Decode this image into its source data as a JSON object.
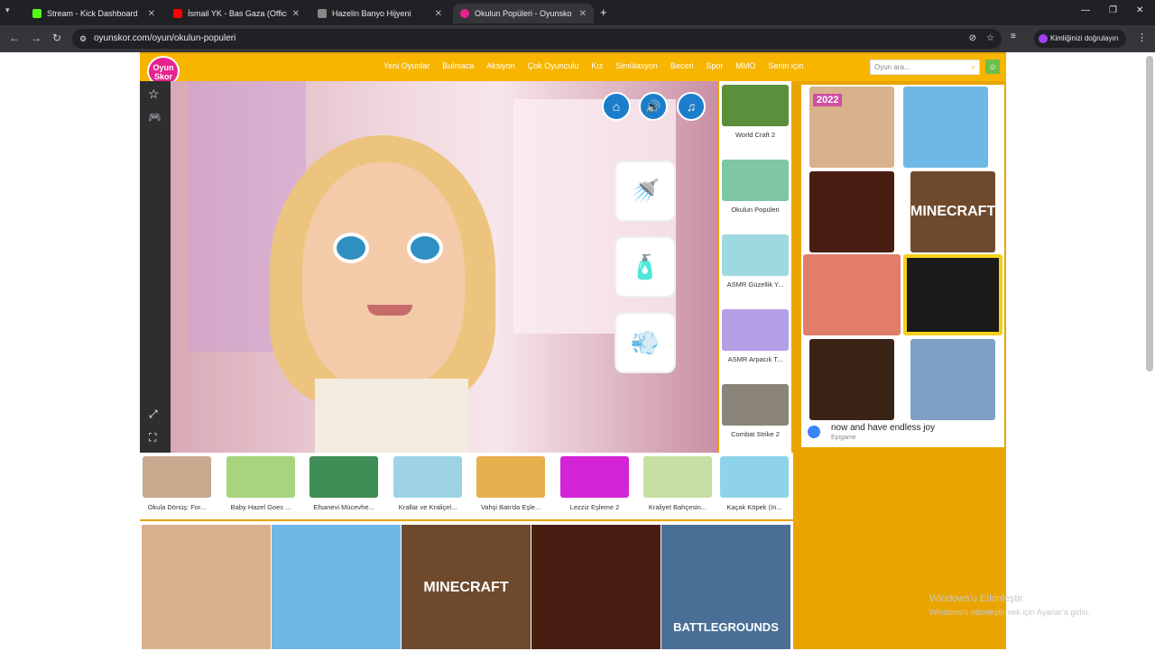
{
  "tabs": [
    {
      "title": "Stream - Kick Dashboard",
      "color": "#53fc18"
    },
    {
      "title": "İsmail YK - Bas Gaza (Offici",
      "color": "#ff0000"
    },
    {
      "title": "Hazelin Banyo Hijyeni",
      "color": "#888888"
    },
    {
      "title": "Okulun Popüleri - Oyunsko",
      "color": "#e8238e"
    }
  ],
  "address": {
    "url": "oyunskor.com/oyun/okulun-populeri",
    "profile": "Kimliğinizi doğrulayın"
  },
  "site": {
    "logo": "Oyun Skor",
    "nav": [
      "Yeni Oyunlar",
      "Bulmaca",
      "Aksiyon",
      "Çok Oyunculu",
      "Kız",
      "Simülasyon",
      "Beceri",
      "Spor",
      "MMO",
      "Senin için"
    ],
    "search_placeholder": "Oyun ara..."
  },
  "side_games": [
    "World Craft 2",
    "Okulun Popüleri",
    "ASMR Güzellik Y...",
    "ASMR Arpacık T...",
    "Combat Strike 2"
  ],
  "bottom_games": [
    "Okula Dönüş: For...",
    "Baby Hazel Goes ...",
    "Efsanevi Mücevhe...",
    "Krallar ve Kraliçel...",
    "Vahşi Batı'da Eşle...",
    "Lezziz Eşleme 2",
    "Kraliyet Bahçesin...",
    "Kaçak Köpek (In..."
  ],
  "ad": {
    "text": "now and have endless joy",
    "sub": "Epigame",
    "minecraft": "MINECRAFT",
    "year": "2022"
  },
  "watermark": {
    "line1": "Windows'u Etkinleştir",
    "line2": "Windows'u etkinleştirmek için Ayarlar'a gidin."
  },
  "bottom_ad": {
    "minecraft": "MINECRAFT",
    "pubg": "BATTLEGROUNDS"
  }
}
